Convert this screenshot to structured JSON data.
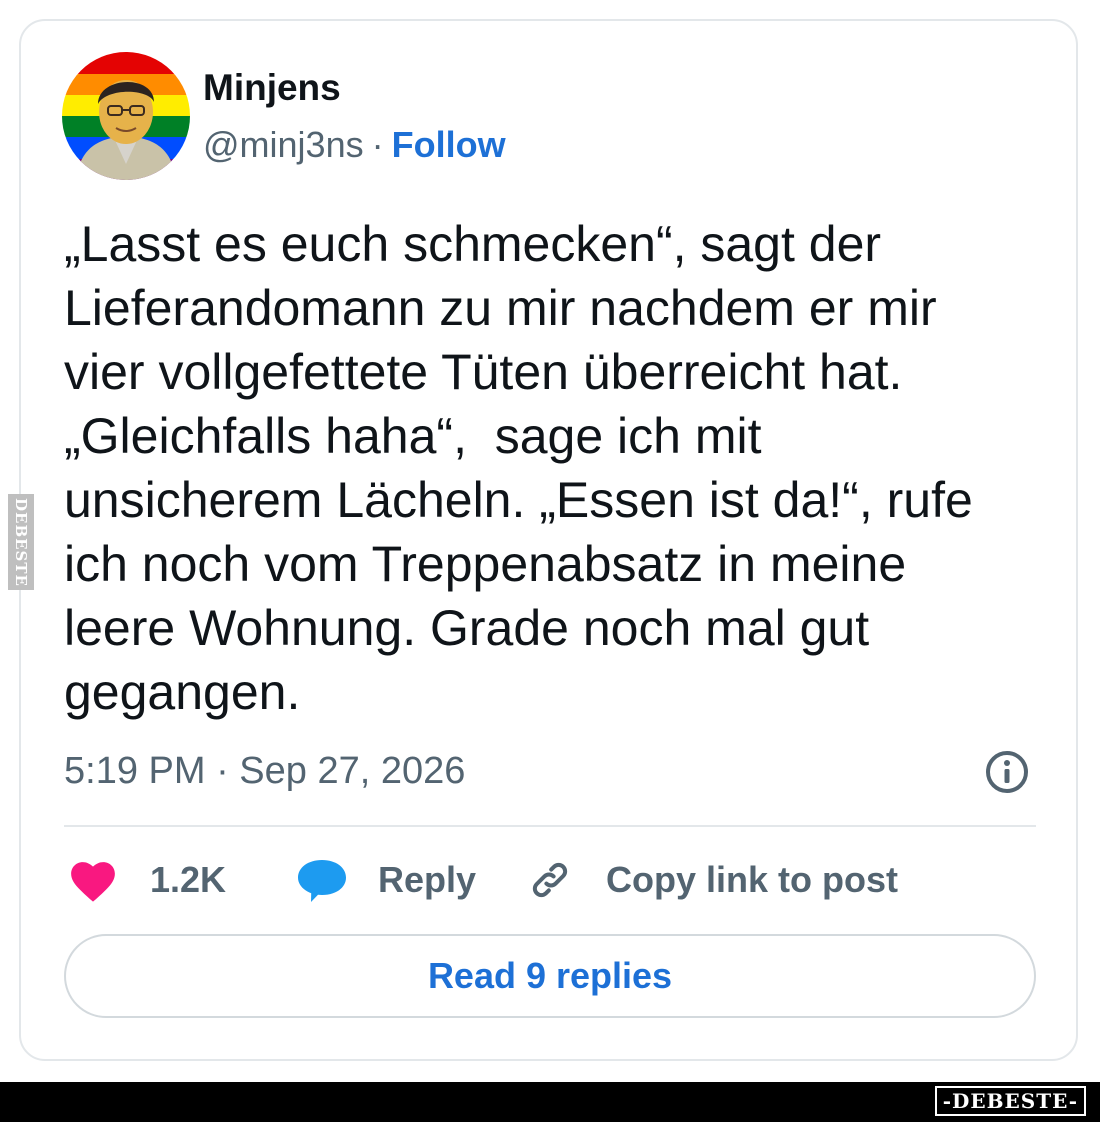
{
  "author": {
    "name": "Minjens",
    "handle": "@minj3ns",
    "separator": "·",
    "follow_label": "Follow"
  },
  "tweet": {
    "lines": [
      "„Lasst es euch schmecken“, sagt der",
      "Lieferandomann zu mir nachdem er mir",
      "vier vollgefettete Tüten überreicht hat.",
      "„Gleichfalls haha“,  sage ich mit",
      "unsicherem Lächeln. „Essen ist da!“, rufe",
      "ich noch vom Treppenabsatz in meine",
      "leere Wohnung. Grade noch mal gut",
      "gegangen."
    ],
    "timestamp": "5:19 PM · Sep 27, 2026"
  },
  "actions": {
    "like_count": "1.2K",
    "reply_label": "Reply",
    "copy_label": "Copy link to post"
  },
  "read_replies_label": "Read 9 replies",
  "watermarks": {
    "side": "DEBESTE",
    "bottom": "-DEBESTE-"
  },
  "colors": {
    "link_blue": "#1d70d6",
    "like_pink": "#f91880",
    "reply_blue": "#1d9bf0",
    "secondary_text": "#536471",
    "border": "#e3e7ea"
  },
  "icons": {
    "like": "heart-icon",
    "reply": "speech-bubble-icon",
    "copy": "link-icon",
    "info": "info-icon"
  }
}
